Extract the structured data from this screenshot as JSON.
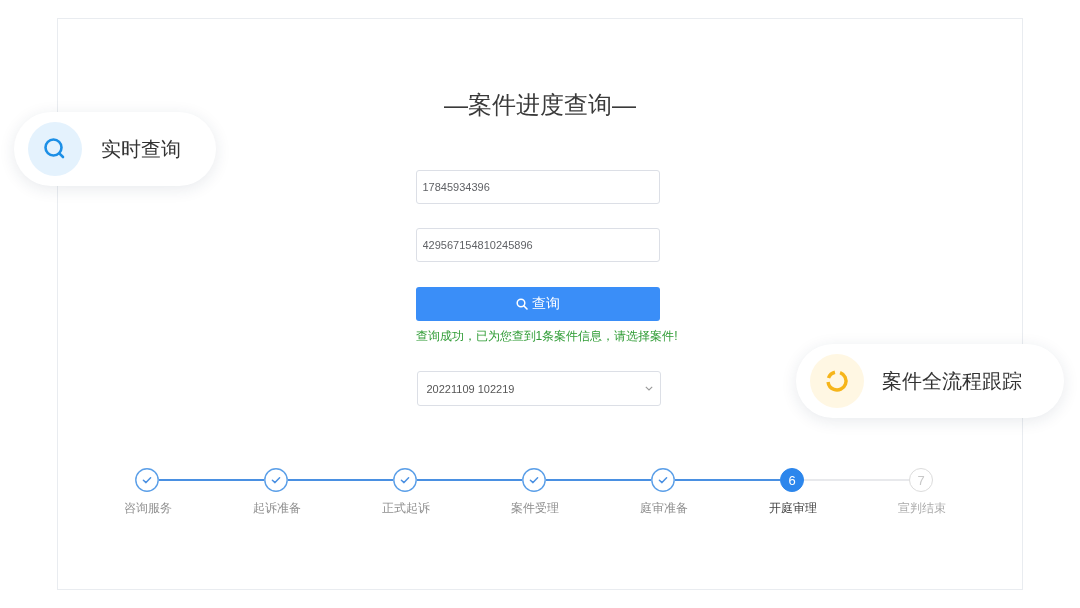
{
  "title": "—案件进度查询—",
  "form": {
    "fields": [
      {
        "value": "17845934396"
      },
      {
        "value": "429567154810245896"
      }
    ],
    "button": {
      "label": "查询"
    },
    "message": "查询成功，已为您查到1条案件信息，请选择案件!",
    "case_select": {
      "value": "20221109 102219"
    }
  },
  "steps": [
    {
      "label": "咨询服务",
      "done": true,
      "current": false
    },
    {
      "label": "起诉准备",
      "done": true,
      "current": false
    },
    {
      "label": "正式起诉",
      "done": true,
      "current": false
    },
    {
      "label": "案件受理",
      "done": true,
      "current": false
    },
    {
      "label": "庭审准备",
      "done": true,
      "current": false
    },
    {
      "label": "开庭审理",
      "done": false,
      "current": true,
      "number": "6"
    },
    {
      "label": "宣判结束",
      "done": false,
      "current": false,
      "number": "7"
    }
  ],
  "badges": [
    {
      "kind": "search",
      "label": "实时查询"
    },
    {
      "kind": "progress",
      "label": "案件全流程跟踪"
    }
  ]
}
